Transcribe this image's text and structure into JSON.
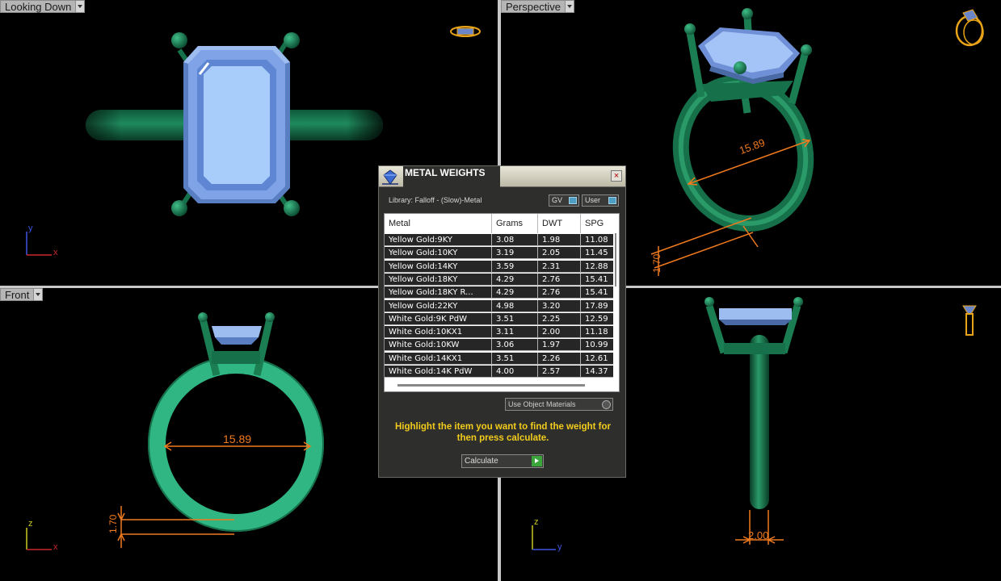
{
  "viewports": {
    "top_left": {
      "label": "Looking Down"
    },
    "top_right": {
      "label": "Perspective"
    },
    "bottom_left": {
      "label": "Front"
    },
    "bottom_right": {
      "label": ""
    }
  },
  "axes": {
    "top_left": {
      "vertical": "y",
      "horizontal": "x"
    },
    "bottom_left": {
      "vertical": "z",
      "horizontal": "x"
    },
    "bottom_right": {
      "vertical": "z",
      "horizontal": "y"
    }
  },
  "dimensions": {
    "perspective_diameter": "15.89",
    "perspective_band": "1.70",
    "front_diameter": "15.89",
    "front_band": "1.70",
    "side_band_width": "2.00"
  },
  "colors": {
    "gem": "#8fb6f0",
    "metal": "#16704a",
    "metal_light": "#2fb682",
    "dimension": "#f07a1e",
    "nav_icon": "#e8a318"
  },
  "dialog": {
    "title": "METAL WEIGHTS",
    "close_glyph": "×",
    "library_label": "Library: Falloff - (Slow)-Metal",
    "toggle_gv": "GV",
    "toggle_user": "User",
    "columns": [
      "Metal",
      "Grams",
      "DWT",
      "SPG"
    ],
    "rows": [
      [
        "Yellow Gold:9KY",
        "3.08",
        "1.98",
        "11.08"
      ],
      [
        "Yellow Gold:10KY",
        "3.19",
        "2.05",
        "11.45"
      ],
      [
        "Yellow Gold:14KY",
        "3.59",
        "2.31",
        "12.88"
      ],
      [
        "Yellow Gold:18KY",
        "4.29",
        "2.76",
        "15.41"
      ],
      [
        "Yellow Gold:18KY R...",
        "4.29",
        "2.76",
        "15.41"
      ],
      [
        "Yellow Gold:22KY",
        "4.98",
        "3.20",
        "17.89"
      ],
      [
        "White Gold:9K PdW",
        "3.51",
        "2.25",
        "12.59"
      ],
      [
        "White Gold:10KX1",
        "3.11",
        "2.00",
        "11.18"
      ],
      [
        "White Gold:10KW",
        "3.06",
        "1.97",
        "10.99"
      ],
      [
        "White Gold:14KX1",
        "3.51",
        "2.26",
        "12.61"
      ],
      [
        "White Gold:14K PdW",
        "4.00",
        "2.57",
        "14.37"
      ]
    ],
    "use_object_materials": "Use Object Materials",
    "instruction": "Highlight the item you want to find the weight for then press calculate.",
    "calculate_label": "Calculate"
  }
}
